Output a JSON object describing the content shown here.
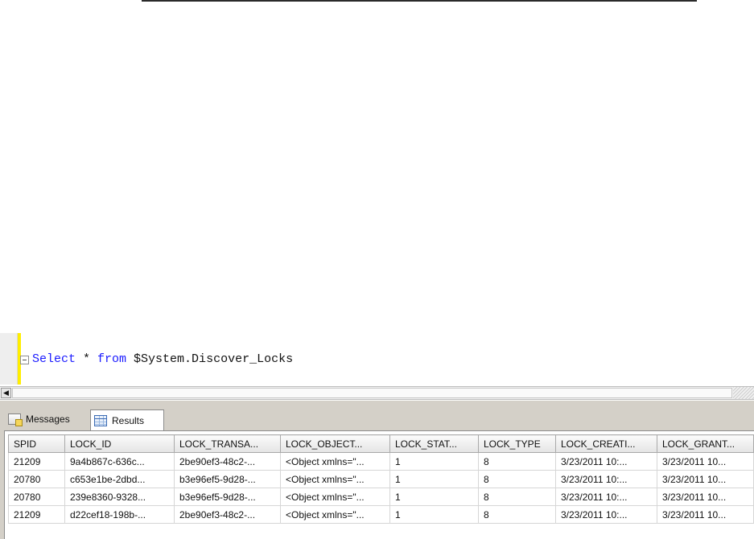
{
  "editor": {
    "query_keyword_select": "Select",
    "query_star": " * ",
    "query_keyword_from": "from",
    "query_object": " $System.Discover_Locks"
  },
  "results_pane": {
    "tabs": [
      {
        "label": "Messages",
        "icon": "messages-icon"
      },
      {
        "label": "Results",
        "icon": "grid-icon",
        "selected": true
      }
    ],
    "columns": [
      "SPID",
      "LOCK_ID",
      "LOCK_TRANSA...",
      "LOCK_OBJECT...",
      "LOCK_STAT...",
      "LOCK_TYPE",
      "LOCK_CREATI...",
      "LOCK_GRANT..."
    ],
    "rows": [
      [
        "21209",
        "9a4b867c-636c...",
        "2be90ef3-48c2-...",
        "<Object xmlns=\"...",
        "1",
        "8",
        "3/23/2011 10:...",
        "3/23/2011 10..."
      ],
      [
        "20780",
        "c653e1be-2dbd...",
        "b3e96ef5-9d28-...",
        "<Object xmlns=\"...",
        "1",
        "8",
        "3/23/2011 10:...",
        "3/23/2011 10..."
      ],
      [
        "20780",
        "239e8360-9328...",
        "b3e96ef5-9d28-...",
        "<Object xmlns=\"...",
        "1",
        "8",
        "3/23/2011 10:...",
        "3/23/2011 10..."
      ],
      [
        "21209",
        "d22cef18-198b-...",
        "2be90ef3-48c2-...",
        "<Object xmlns=\"...",
        "1",
        "8",
        "3/23/2011 10:...",
        "3/23/2011 10..."
      ]
    ]
  },
  "colors": {
    "keyword": "#1a1aff",
    "edit_marker": "#ffee00",
    "pane_background": "#d4d0c8"
  }
}
